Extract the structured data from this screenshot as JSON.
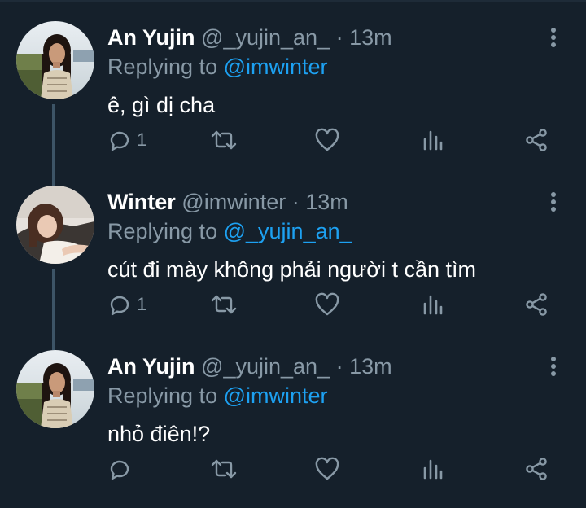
{
  "colors": {
    "background": "#15202b",
    "text_primary": "#ffffff",
    "text_secondary": "#8899a6",
    "mention": "#1da1f2",
    "thread_line": "#3d5466"
  },
  "tweets": [
    {
      "display_name": "An Yujin",
      "handle": "@_yujin_an_",
      "separator": "·",
      "time": "13m",
      "replying_prefix": "Replying to",
      "replying_to": "@imwinter",
      "text": "ê, gì dị cha",
      "reply_count": "1",
      "avatar": "avatar-an-yujin"
    },
    {
      "display_name": "Winter",
      "handle": "@imwinter",
      "separator": "·",
      "time": "13m",
      "replying_prefix": "Replying to",
      "replying_to": "@_yujin_an_",
      "text": "cút đi mày không phải người t cần tìm",
      "reply_count": "1",
      "avatar": "avatar-winter"
    },
    {
      "display_name": "An Yujin",
      "handle": "@_yujin_an_",
      "separator": "·",
      "time": "13m",
      "replying_prefix": "Replying to",
      "replying_to": "@imwinter",
      "text": "nhỏ điên!?",
      "reply_count": "",
      "avatar": "avatar-an-yujin"
    }
  ],
  "action_icons": [
    "reply-icon",
    "retweet-icon",
    "like-icon",
    "analytics-icon",
    "share-icon"
  ]
}
